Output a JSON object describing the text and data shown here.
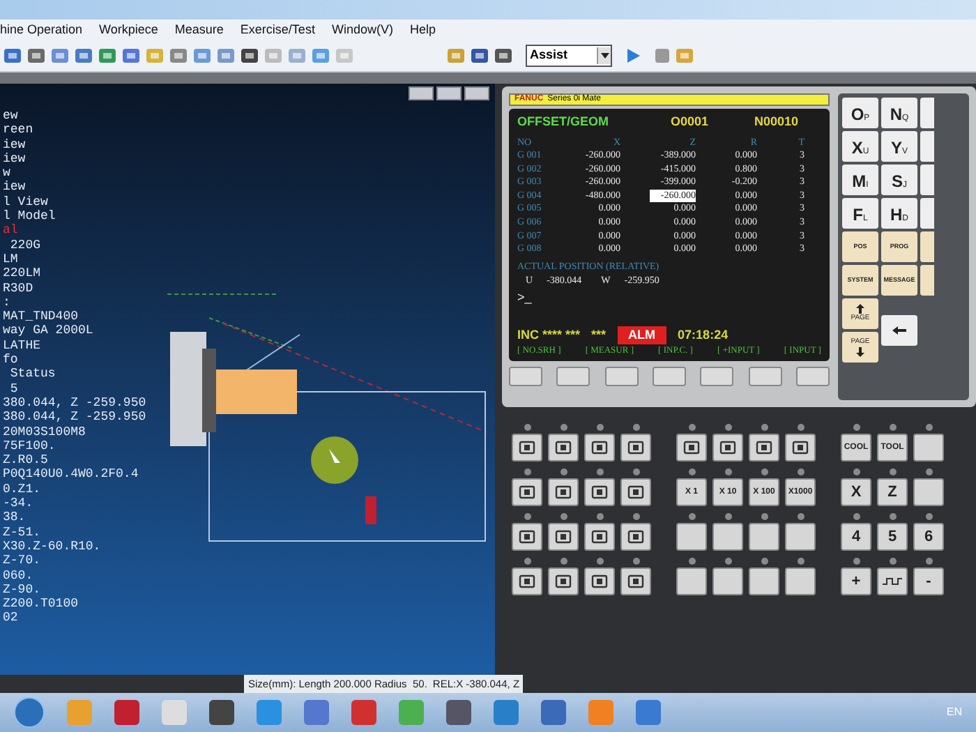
{
  "menu": [
    "hine Operation",
    "Workpiece",
    "Measure",
    "Exercise/Test",
    "Window(V)",
    "Help"
  ],
  "toolbar": {
    "mode": "Assist"
  },
  "viewport": {
    "lines": [
      {
        "text": "ew",
        "highlighted": false
      },
      {
        "text": "reen",
        "highlighted": false
      },
      {
        "text": "iew",
        "highlighted": false
      },
      {
        "text": "iew",
        "highlighted": false
      },
      {
        "text": "w",
        "highlighted": false
      },
      {
        "text": "iew",
        "highlighted": false
      },
      {
        "text": "l View",
        "highlighted": false
      },
      {
        "text": "l Model",
        "highlighted": false
      },
      {
        "text": "al",
        "highlighted": true
      },
      {
        "text": " 220G",
        "highlighted": false
      },
      {
        "text": "LM",
        "highlighted": false
      },
      {
        "text": "220LM",
        "highlighted": false
      },
      {
        "text": "R30D",
        "highlighted": false
      },
      {
        "text": ":",
        "highlighted": false
      },
      {
        "text": "MAT_TND400",
        "highlighted": false
      },
      {
        "text": "way GA 2000L",
        "highlighted": false
      },
      {
        "text": "LATHE",
        "highlighted": false
      },
      {
        "text": "fo",
        "highlighted": false
      },
      {
        "text": " Status",
        "highlighted": false
      },
      {
        "text": " 5",
        "highlighted": false
      },
      {
        "text": "380.044, Z -259.950",
        "highlighted": false
      },
      {
        "text": "380.044, Z -259.950",
        "highlighted": false
      },
      {
        "text": "20M03S100M8",
        "highlighted": false
      },
      {
        "text": "75F100.",
        "highlighted": false
      },
      {
        "text": "Z.R0.5",
        "highlighted": false
      },
      {
        "text": "P0Q140U0.4W0.2F0.4",
        "highlighted": false
      },
      {
        "text": "0.Z1.",
        "highlighted": false
      },
      {
        "text": "-34.",
        "highlighted": false
      },
      {
        "text": "38.",
        "highlighted": false
      },
      {
        "text": "Z-51.",
        "highlighted": false
      },
      {
        "text": "X30.Z-60.R10.",
        "highlighted": false
      },
      {
        "text": "Z-70.",
        "highlighted": false
      },
      {
        "text": "060.",
        "highlighted": false
      },
      {
        "text": "Z-90.",
        "highlighted": false
      },
      {
        "text": "Z200.T0100",
        "highlighted": false
      },
      {
        "text": "02",
        "highlighted": false
      }
    ]
  },
  "screen": {
    "brand": "FANUC",
    "series": "Series 0i Mate",
    "title": "OFFSET/GEOM",
    "program": "O0001",
    "sequence": "N00010",
    "columns": [
      "NO",
      "X",
      "Z",
      "R",
      "T"
    ],
    "rows": [
      {
        "cells": [
          "G 001",
          "-260.000",
          "-389.000",
          "0.000",
          "3"
        ],
        "selected": false
      },
      {
        "cells": [
          "G 002",
          "-260.000",
          "-415.000",
          "0.800",
          "3"
        ],
        "selected": false
      },
      {
        "cells": [
          "G 003",
          "-260.000",
          "-399.000",
          "-0.200",
          "3"
        ],
        "selected": false
      },
      {
        "cells": [
          "G 004",
          "-480.000",
          "-260.000",
          "0.000",
          "3"
        ],
        "selected": true
      },
      {
        "cells": [
          "G 005",
          "0.000",
          "0.000",
          "0.000",
          "3"
        ],
        "selected": false
      },
      {
        "cells": [
          "G 006",
          "0.000",
          "0.000",
          "0.000",
          "3"
        ],
        "selected": false
      },
      {
        "cells": [
          "G 007",
          "0.000",
          "0.000",
          "0.000",
          "3"
        ],
        "selected": false
      },
      {
        "cells": [
          "G 008",
          "0.000",
          "0.000",
          "0.000",
          "3"
        ],
        "selected": false
      }
    ],
    "position_label": "ACTUAL POSITION (RELATIVE)",
    "position": [
      {
        "axis": "U",
        "value": "-380.044"
      },
      {
        "axis": "W",
        "value": "-259.950"
      }
    ],
    "prompt": ">_",
    "mode": "INC **** ***",
    "mode_2": "***",
    "alarm": "ALM",
    "time": "07:18:24",
    "softkeys": [
      "[ NO.SRH ]",
      "[ MEASUR ]",
      "[ INP.C. ]",
      "[ +INPUT ]",
      "[ INPUT ]"
    ]
  },
  "keypad": {
    "address_keys": [
      {
        "main": "O",
        "sub": "P"
      },
      {
        "main": "N",
        "sub": "Q"
      },
      {
        "main": "X",
        "sub": "U"
      },
      {
        "main": "Y",
        "sub": "V"
      },
      {
        "main": "M",
        "sub": "I"
      },
      {
        "main": "S",
        "sub": "J"
      },
      {
        "main": "F",
        "sub": "L"
      },
      {
        "main": "H",
        "sub": "D"
      }
    ],
    "function_keys": [
      "POS",
      "PROG",
      "SYSTEM",
      "MESSAGE"
    ],
    "page_keys": [
      "PAGE",
      "PAGE"
    ]
  },
  "operator_panel": {
    "step_keys": [
      "X 1",
      "X 10",
      "X 100",
      "X1000"
    ],
    "right_keys": [
      "COOL",
      "TOOL"
    ],
    "axis_keys": [
      "X",
      "Z",
      "4",
      "5",
      "6",
      "+",
      "-"
    ]
  },
  "status_bar": {
    "size": "Size(mm): Length 200.000 Radius  50.",
    "position": "REL:X -380.044, Z"
  },
  "taskbar": {
    "language": "EN"
  }
}
